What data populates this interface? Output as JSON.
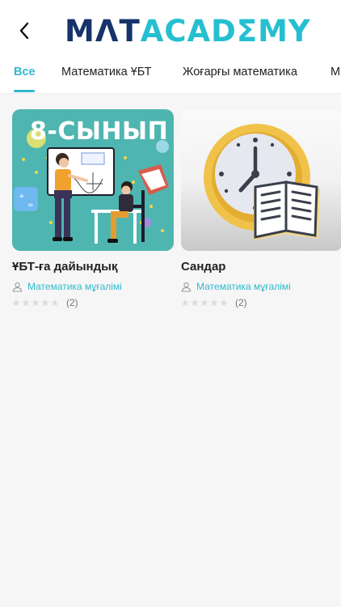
{
  "header": {
    "logo_part1": "MΛT",
    "logo_part2": "ACADΣMY"
  },
  "tabs": [
    {
      "label": "Все",
      "active": true
    },
    {
      "label": "Математика ҰБТ",
      "active": false
    },
    {
      "label": "Жоғарғы математика",
      "active": false
    },
    {
      "label": "М",
      "active": false
    }
  ],
  "courses": [
    {
      "title": "ҰБТ-ға дайындық",
      "image_text": "8-СЫНЫП",
      "author": "Математика мұғалімі",
      "rating": 0,
      "rating_count": "(2)"
    },
    {
      "title": "Сандар",
      "author": "Математика мұғалімі",
      "rating": 0,
      "rating_count": "(2)"
    }
  ],
  "colors": {
    "accent": "#2fb9cf",
    "brand_dark": "#17336b",
    "card1_bg": "#4fb5b0"
  }
}
